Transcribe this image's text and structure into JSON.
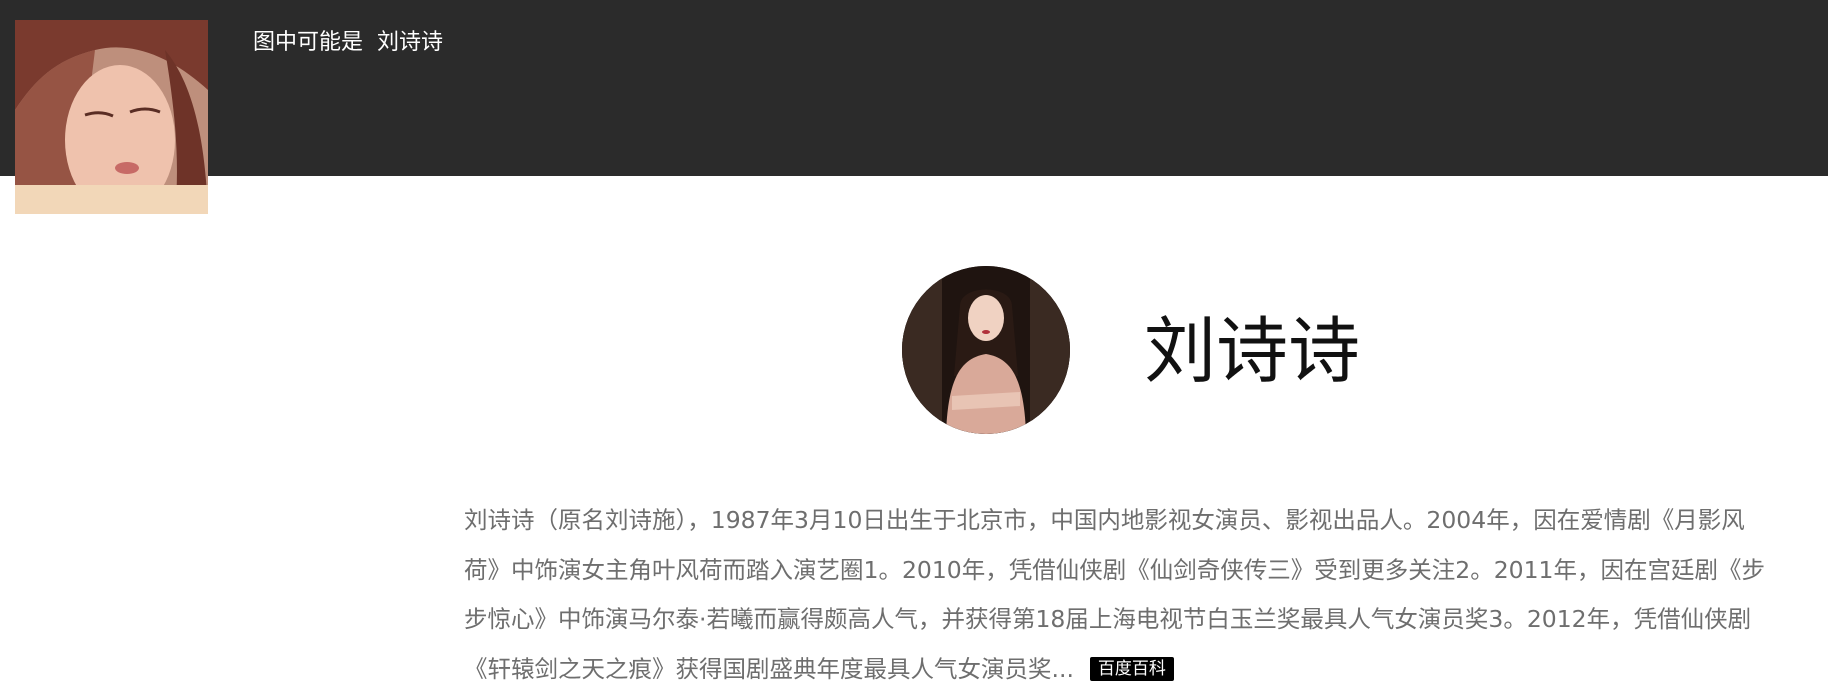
{
  "header": {
    "prefix": "图中可能是",
    "name": "刘诗诗"
  },
  "images": {
    "query_thumbnail": "query-face-image",
    "profile_photo": "person-portrait-image"
  },
  "entity": {
    "name": "刘诗诗",
    "description": "刘诗诗（原名刘诗施），1987年3月10日出生于北京市，中国内地影视女演员、影视出品人。2004年，因在爱情剧《月影风荷》中饰演女主角叶风荷而踏入演艺圈1。2010年，凭借仙侠剧《仙剑奇侠传三》受到更多关注2。2011年，因在宫廷剧《步步惊心》中饰演马尔泰·若曦而赢得颇高人气，并获得第18届上海电视节白玉兰奖最具人气女演员奖3。2012年，凭借仙侠剧《轩辕剑之天之痕》获得国剧盛典年度最具人气女演员奖...",
    "source_label": "百度百科"
  },
  "colors": {
    "topbar_bg": "#2b2b2b",
    "text_gray": "#6e6e6e",
    "badge_bg": "#000000"
  }
}
